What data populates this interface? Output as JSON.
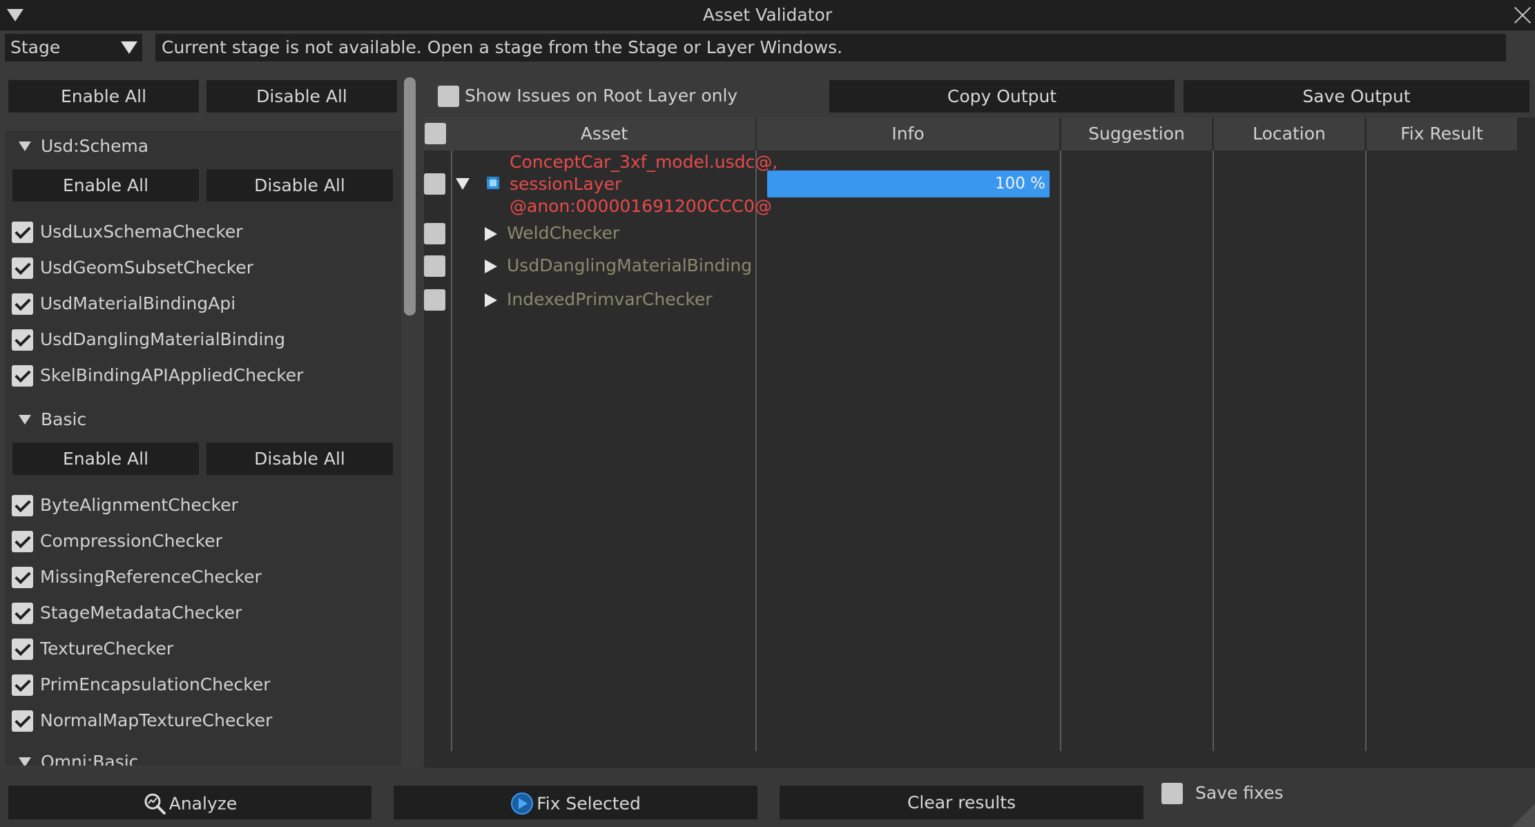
{
  "window": {
    "title": "Asset Validator"
  },
  "top": {
    "mode_select": "Stage",
    "message": "Current stage is not available. Open a stage from the Stage or Layer Windows."
  },
  "left": {
    "enable_all": "Enable All",
    "disable_all": "Disable All",
    "groups": [
      {
        "name": "Usd:Schema",
        "enable_all": "Enable All",
        "disable_all": "Disable All",
        "checkers": [
          "UsdLuxSchemaChecker",
          "UsdGeomSubsetChecker",
          "UsdMaterialBindingApi",
          "UsdDanglingMaterialBinding",
          "SkelBindingAPIAppliedChecker"
        ]
      },
      {
        "name": "Basic",
        "enable_all": "Enable All",
        "disable_all": "Disable All",
        "checkers": [
          "ByteAlignmentChecker",
          "CompressionChecker",
          "MissingReferenceChecker",
          "StageMetadataChecker",
          "TextureChecker",
          "PrimEncapsulationChecker",
          "NormalMapTextureChecker"
        ]
      },
      {
        "name": "Omni:Basic"
      }
    ]
  },
  "right": {
    "show_issues_label": "Show Issues on Root Layer only",
    "copy_output": "Copy Output",
    "save_output": "Save Output",
    "columns": [
      "Asset",
      "Info",
      "Suggestion",
      "Location",
      "Fix Result"
    ],
    "root": {
      "line1": "ConceptCar_3xf_model.usdc@,",
      "line2": "sessionLayer",
      "line3": "@anon:000001691200CCC0@",
      "progress_percent": 100,
      "progress_label": "100 %"
    },
    "children": [
      "WeldChecker",
      "UsdDanglingMaterialBinding",
      "IndexedPrimvarChecker"
    ]
  },
  "bottom": {
    "analyze": "Analyze",
    "fix_selected": "Fix Selected",
    "clear_results": "Clear results",
    "save_fixes": "Save fixes"
  },
  "colors": {
    "accent_progress": "#3a97f0",
    "error_text": "#e84a4a",
    "muted_text": "#8a8a6e",
    "panel_bg": "#3a3a3a",
    "dark_widget": "#1f1f1f"
  }
}
